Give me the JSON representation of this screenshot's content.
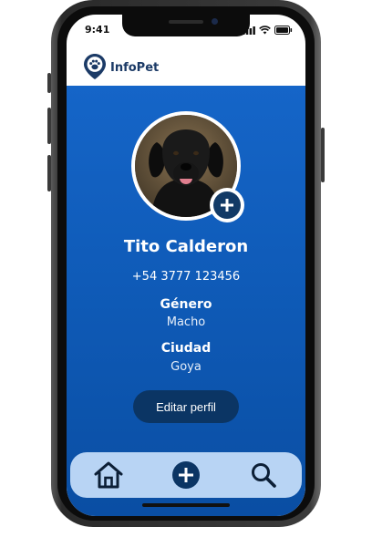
{
  "status_bar": {
    "time": "9:41"
  },
  "header": {
    "brand": "InfoPet"
  },
  "profile": {
    "name": "Tito Calderon",
    "phone": "+54 3777 123456",
    "gender_label": "Género",
    "gender_value": "Macho",
    "city_label": "Ciudad",
    "city_value": "Goya"
  },
  "actions": {
    "edit_profile": "Editar perfil"
  },
  "tabbar": {
    "icons": [
      "home-icon",
      "add-icon",
      "search-icon"
    ]
  },
  "colors": {
    "primary": "#1565c8",
    "dark": "#0b3564",
    "tabbar": "#b8d4f4"
  }
}
